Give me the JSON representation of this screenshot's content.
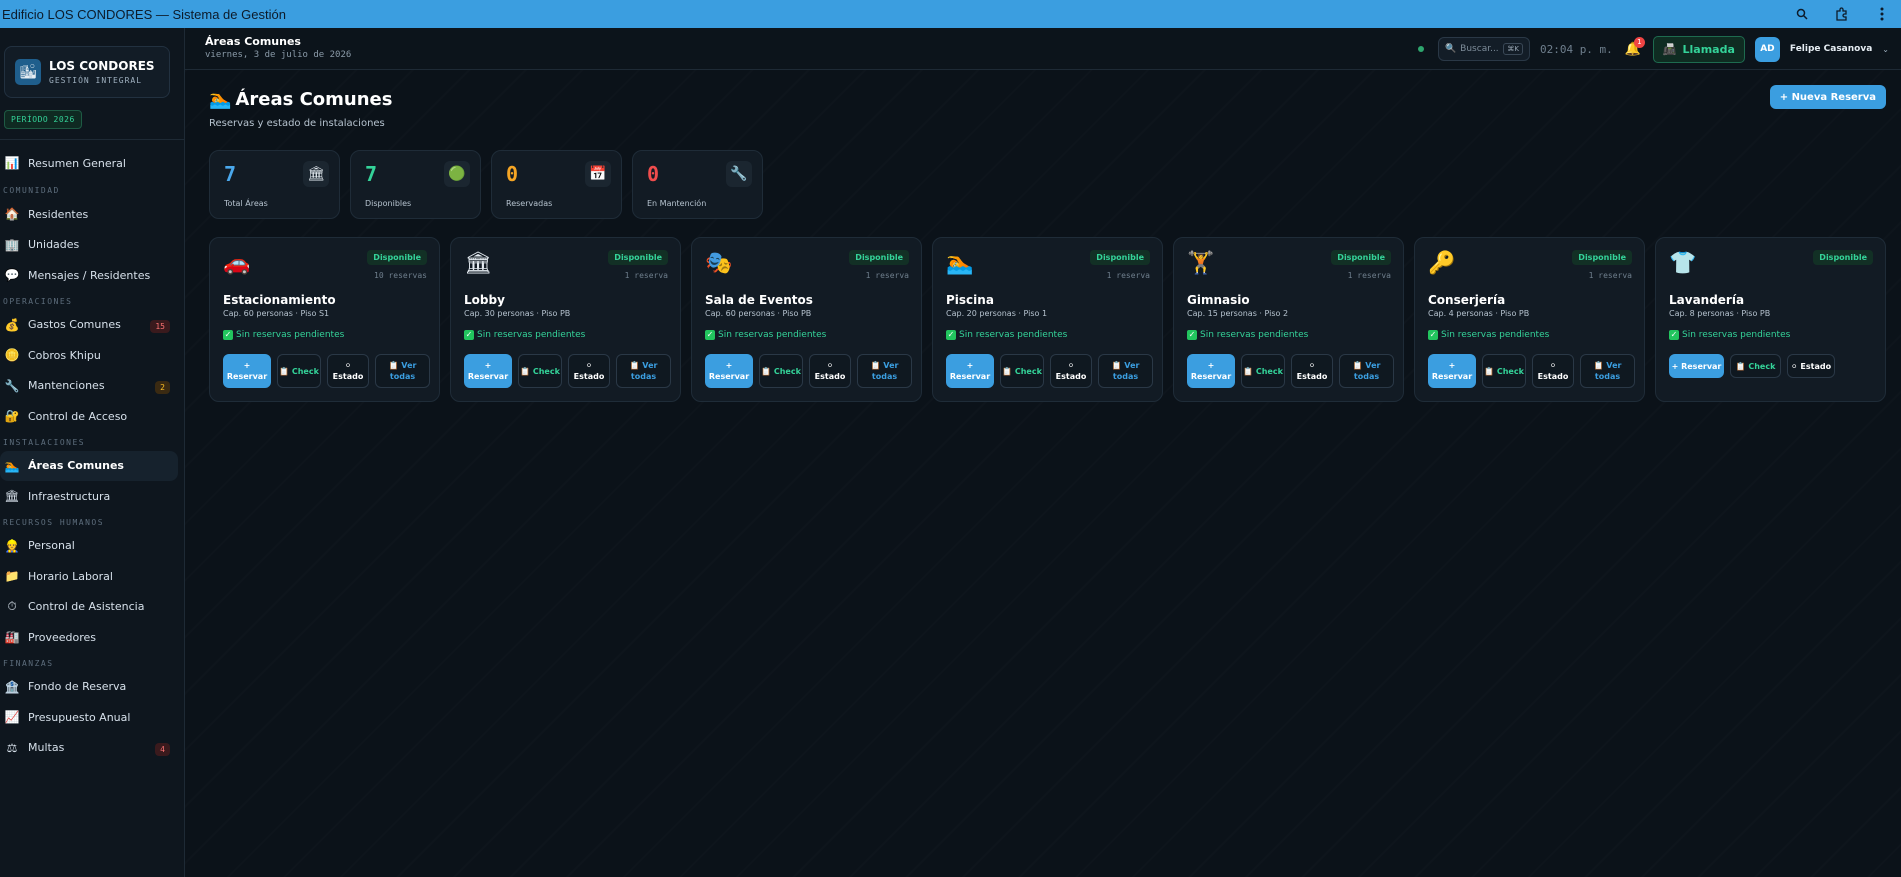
{
  "window": {
    "title": "Edificio LOS CONDORES — Sistema de Gestión",
    "icons": [
      "zoom-icon",
      "extension-icon",
      "more-vert-icon"
    ]
  },
  "brand": {
    "name": "LOS CONDORES",
    "subtitle": "GESTIÓN INTEGRAL",
    "period": "PERÍODO 2026"
  },
  "sidebar": {
    "top_item": {
      "label": "Resumen General",
      "icon": "📊"
    },
    "sections": [
      {
        "title": "COMUNIDAD",
        "items": [
          {
            "label": "Residentes",
            "icon": "🏠"
          },
          {
            "label": "Unidades",
            "icon": "🏢"
          },
          {
            "label": "Mensajes / Residentes",
            "icon": "💬"
          }
        ]
      },
      {
        "title": "OPERACIONES",
        "items": [
          {
            "label": "Gastos Comunes",
            "icon": "💰",
            "badge": "15",
            "badge_color": "red"
          },
          {
            "label": "Cobros Khipu",
            "icon": "🪙"
          },
          {
            "label": "Mantenciones",
            "icon": "🔧",
            "badge": "2",
            "badge_color": "orange"
          },
          {
            "label": "Control de Acceso",
            "icon": "🔐"
          }
        ]
      },
      {
        "title": "INSTALACIONES",
        "items": [
          {
            "label": "Áreas Comunes",
            "icon": "🏊",
            "active": true
          },
          {
            "label": "Infraestructura",
            "icon": "🏛"
          }
        ]
      },
      {
        "title": "RECURSOS HUMANOS",
        "items": [
          {
            "label": "Personal",
            "icon": "👷"
          },
          {
            "label": "Horario Laboral",
            "icon": "📁"
          },
          {
            "label": "Control de Asistencia",
            "icon": "⏱"
          },
          {
            "label": "Proveedores",
            "icon": "🏭"
          }
        ]
      },
      {
        "title": "FINANZAS",
        "items": [
          {
            "label": "Fondo de Reserva",
            "icon": "🏦"
          },
          {
            "label": "Presupuesto Anual",
            "icon": "📈"
          },
          {
            "label": "Multas",
            "icon": "⚖",
            "badge": "4",
            "badge_color": "red"
          }
        ]
      }
    ]
  },
  "header": {
    "title": "Áreas Comunes",
    "date": "viernes, 3 de julio de 2026",
    "search_placeholder": "Buscar...",
    "search_kbd": "⌘K",
    "clock": "02:04 p. m.",
    "notif_count": "1",
    "call_button": "Llamada",
    "user_initials": "AD",
    "user_name": "Felipe Casanova"
  },
  "page": {
    "title": "Áreas Comunes",
    "title_icon": "🏊",
    "subtitle": "Reservas y estado de instalaciones",
    "new_button": "+ Nueva Reserva"
  },
  "stats": [
    {
      "value": "7",
      "label": "Total Áreas",
      "icon": "🏛",
      "color": "#4aa8ec"
    },
    {
      "value": "7",
      "label": "Disponibles",
      "icon": "🟢",
      "color": "#34d399"
    },
    {
      "value": "0",
      "label": "Reservadas",
      "icon": "📅",
      "color": "#f5a524"
    },
    {
      "value": "0",
      "label": "En Mantención",
      "icon": "🔧",
      "color": "#f04d4d"
    }
  ],
  "areas": [
    {
      "icon": "🚗",
      "name": "Estacionamiento",
      "meta": "Cap. 60 personas · Piso S1",
      "badge": "Disponible",
      "reservations": "10 reservas",
      "status": "Sin reservas pendientes"
    },
    {
      "icon": "🏛",
      "name": "Lobby",
      "meta": "Cap. 30 personas · Piso PB",
      "badge": "Disponible",
      "reservations": "1 reserva",
      "status": "Sin reservas pendientes"
    },
    {
      "icon": "🎭",
      "name": "Sala de Eventos",
      "meta": "Cap. 60 personas · Piso PB",
      "badge": "Disponible",
      "reservations": "1 reserva",
      "status": "Sin reservas pendientes"
    },
    {
      "icon": "🏊",
      "name": "Piscina",
      "meta": "Cap. 20 personas · Piso 1",
      "badge": "Disponible",
      "reservations": "1 reserva",
      "status": "Sin reservas pendientes"
    },
    {
      "icon": "🏋",
      "name": "Gimnasio",
      "meta": "Cap. 15 personas · Piso 2",
      "badge": "Disponible",
      "reservations": "1 reserva",
      "status": "Sin reservas pendientes"
    },
    {
      "icon": "🔑",
      "name": "Conserjería",
      "meta": "Cap. 4 personas · Piso PB",
      "badge": "Disponible",
      "reservations": "1 reserva",
      "status": "Sin reservas pendientes"
    },
    {
      "icon": "👕",
      "name": "Lavandería",
      "meta": "Cap. 8 personas · Piso PB",
      "badge": "Disponible",
      "reservations": "",
      "status": "Sin reservas pendientes",
      "compact": true
    }
  ],
  "actions": {
    "reserve": "+ Reservar",
    "check": "📋 Check",
    "estado": "⚪ Estado",
    "ver": "📋 Ver todas"
  }
}
